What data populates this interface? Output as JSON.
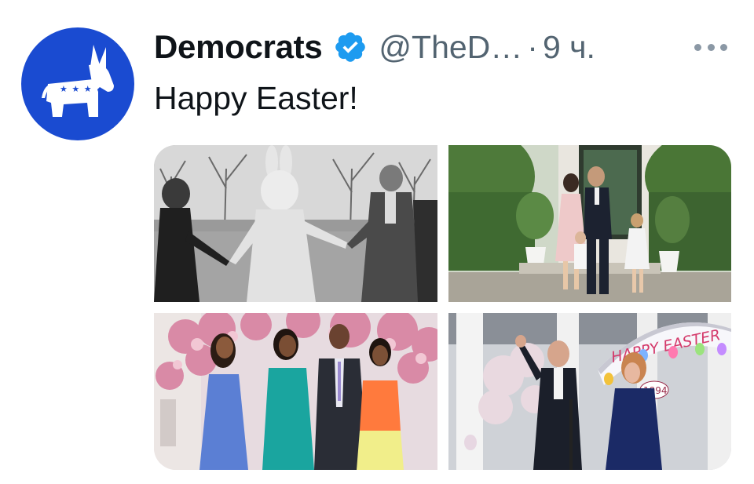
{
  "tweet": {
    "author_name": "Democrats",
    "handle": "@TheD…",
    "separator": "·",
    "time": "9 ч.",
    "text": "Happy Easter!",
    "more_icon": "ellipsis-horizontal-icon",
    "verified_icon": "verified-badge-icon",
    "verified_color": "#1d9bf0",
    "avatar_icon": "democratic-donkey-logo",
    "avatar_color": "#1a4bd1",
    "avatar_stars": "★ ★ ★"
  },
  "media": {
    "photos": [
      {
        "name": "photo-easter-bunny-bw"
      },
      {
        "name": "photo-family-doorway"
      },
      {
        "name": "photo-family-magnolia"
      },
      {
        "name": "photo-1994-easter-arch",
        "banner_text": "HAPPY EASTER",
        "banner_year": "1994"
      }
    ]
  }
}
